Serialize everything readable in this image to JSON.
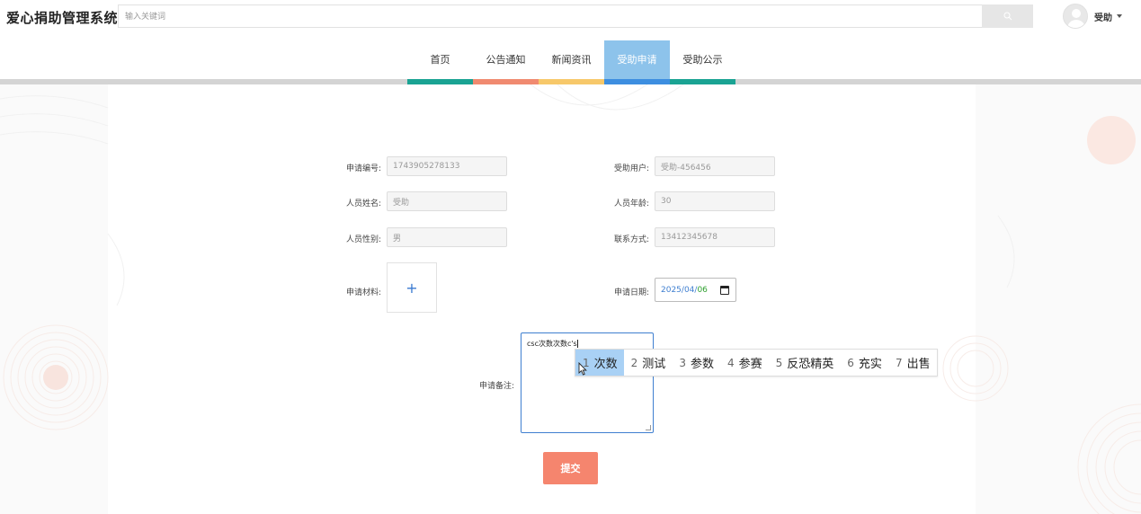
{
  "app": {
    "title": "爱心捐助管理系统"
  },
  "search": {
    "placeholder": "输入关键词"
  },
  "user": {
    "name": "受助"
  },
  "nav": {
    "items": [
      {
        "label": "首页",
        "stripe_color": "#1aa393"
      },
      {
        "label": "公告通知",
        "stripe_color": "#f08a70"
      },
      {
        "label": "新闻资讯",
        "stripe_color": "#f7c86a"
      },
      {
        "label": "受助申请",
        "stripe_color": "#3d8ee0",
        "active": true
      },
      {
        "label": "受助公示",
        "stripe_color": "#1aa393"
      }
    ],
    "active_bg": "#8dc3eb"
  },
  "form": {
    "application_no": {
      "label": "申请编号:",
      "value": "1743905278133"
    },
    "aided_user": {
      "label": "受助用户:",
      "value": "受助-456456"
    },
    "person_name": {
      "label": "人员姓名:",
      "value": "受助"
    },
    "person_age": {
      "label": "人员年龄:",
      "value": "30"
    },
    "person_gender": {
      "label": "人员性别:",
      "value": "男"
    },
    "contact": {
      "label": "联系方式:",
      "value": "13412345678"
    },
    "materials": {
      "label": "申请材料:",
      "upload_symbol": "+"
    },
    "apply_date": {
      "label": "申请日期:",
      "year": "2025",
      "month": "04",
      "day": "06",
      "sep": "/"
    },
    "remark": {
      "label": "申请备注:",
      "value": "csc次数次数c's"
    },
    "submit_label": "提交"
  },
  "ime": {
    "candidates": [
      {
        "num": "1",
        "text": "次数"
      },
      {
        "num": "2",
        "text": "测试"
      },
      {
        "num": "3",
        "text": "参数"
      },
      {
        "num": "4",
        "text": "参赛"
      },
      {
        "num": "5",
        "text": "反恐精英"
      },
      {
        "num": "6",
        "text": "充实"
      },
      {
        "num": "7",
        "text": "出售"
      }
    ],
    "selected_index": 0
  },
  "colors": {
    "accent": "#3f7fd0",
    "submit": "#f5856e"
  }
}
